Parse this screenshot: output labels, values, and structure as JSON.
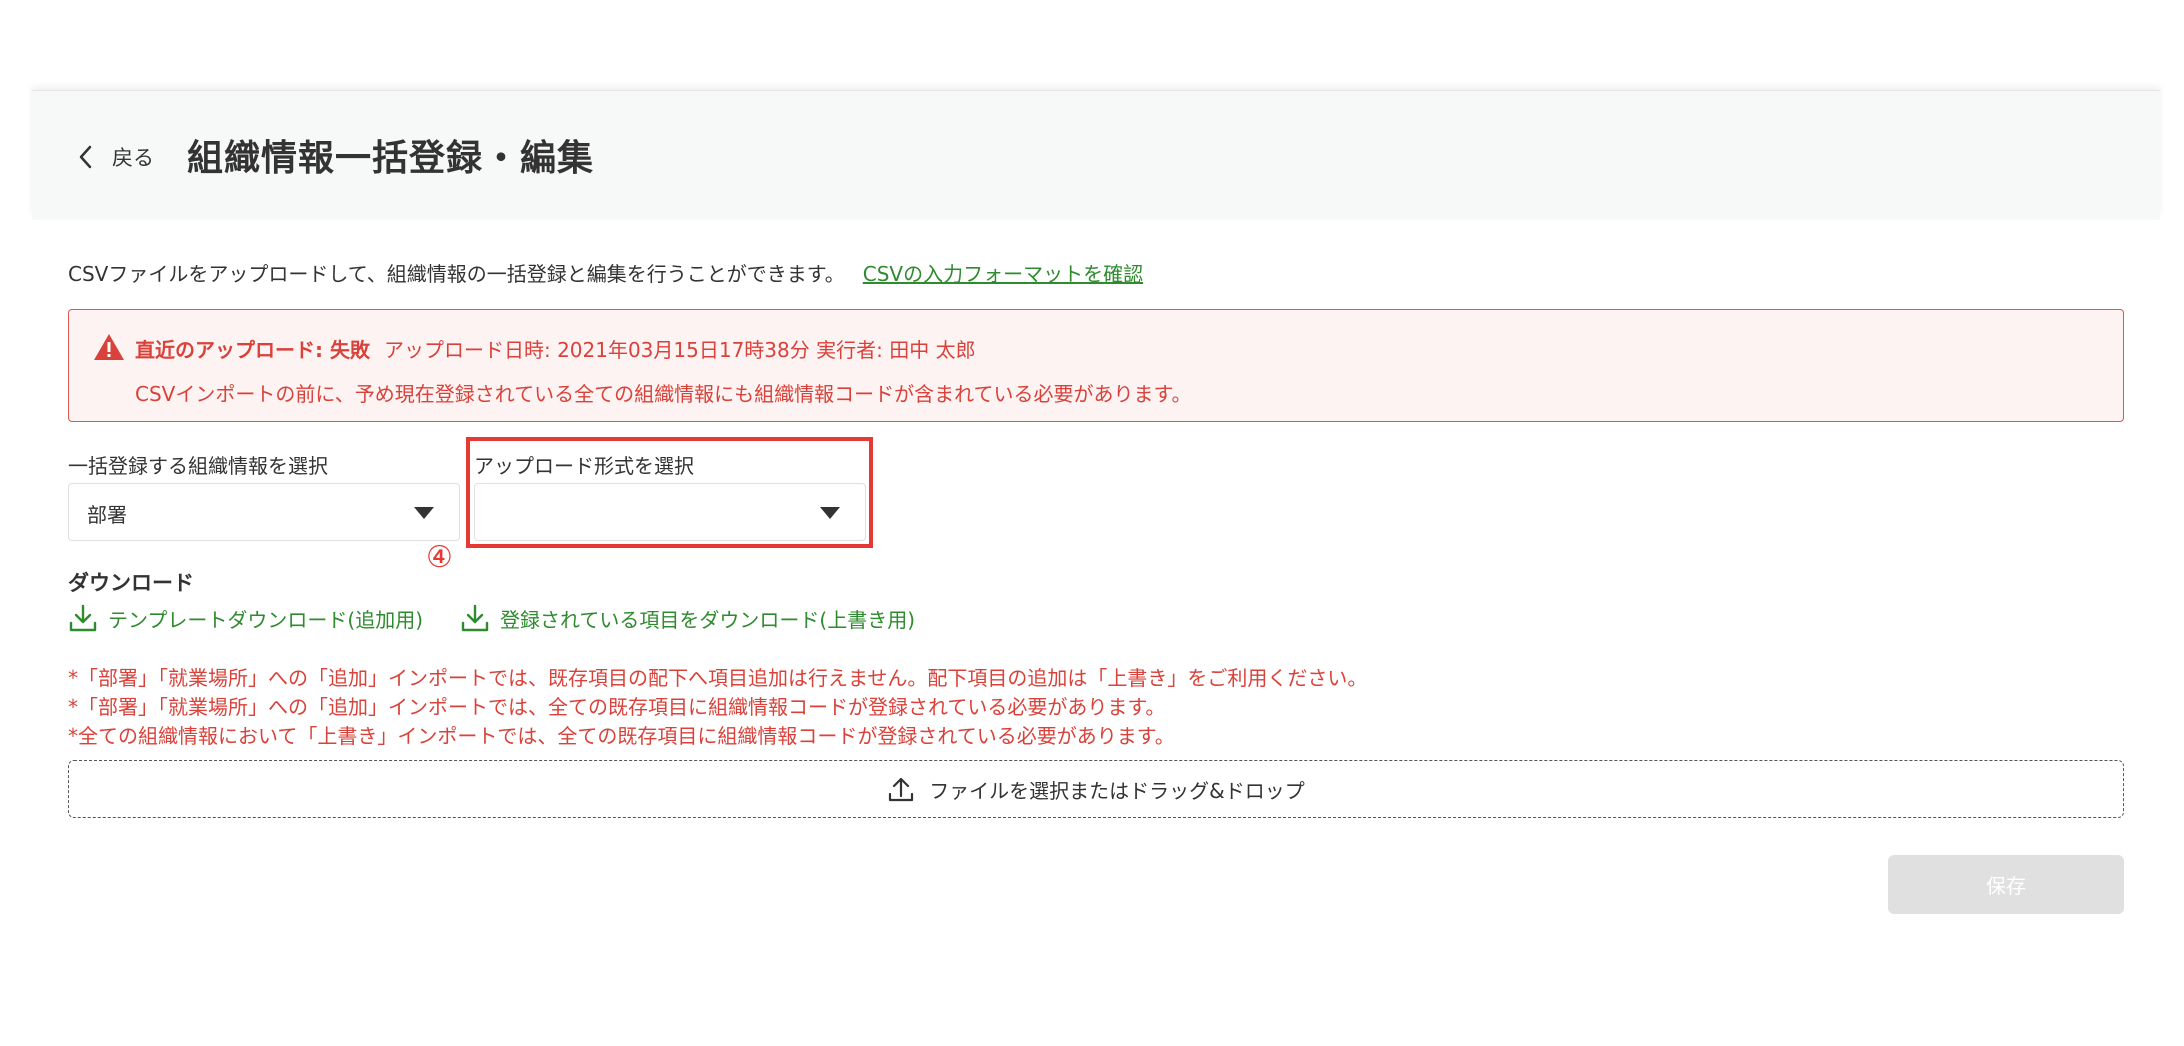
{
  "header": {
    "back_label": "戻る",
    "title": "組織情報一括登録・編集"
  },
  "intro": {
    "text": "CSVファイルをアップロードして、組織情報の一括登録と編集を行うことができます。",
    "link": "CSVの入力フォーマットを確認"
  },
  "alert": {
    "status": "直近のアップロード: 失敗",
    "meta": "アップロード日時: 2021年03月15日17時38分  実行者: 田中 太郎",
    "message": "CSVインポートの前に、予め現在登録されている全ての組織情報にも組織情報コードが含まれている必要があります。",
    "color": "#d9423a"
  },
  "fields": {
    "org_type": {
      "label": "一括登録する組織情報を選択",
      "value": "部署"
    },
    "upload_mode": {
      "label": "アップロード形式を選択",
      "value": ""
    }
  },
  "annotation": {
    "marker": "④",
    "color": "#e53935"
  },
  "download": {
    "title": "ダウンロード",
    "template_link": "テンプレートダウンロード(追加用)",
    "existing_link": "登録されている項目をダウンロード(上書き用)"
  },
  "notes": [
    "*「部署」「就業場所」への「追加」インポートでは、既存項目の配下へ項目追加は行えません。配下項目の追加は「上書き」をご利用ください。",
    "*「部署」「就業場所」への「追加」インポートでは、全ての既存項目に組織情報コードが登録されている必要があります。",
    "*全ての組織情報において「上書き」インポートでは、全ての既存項目に組織情報コードが登録されている必要があります。"
  ],
  "dropzone": {
    "label": "ファイルを選択またはドラッグ&ドロップ"
  },
  "actions": {
    "save_label": "保存"
  },
  "colors": {
    "link": "#2e8b2e",
    "accent_red": "#d9423a",
    "disabled": "#e0e0e0"
  }
}
